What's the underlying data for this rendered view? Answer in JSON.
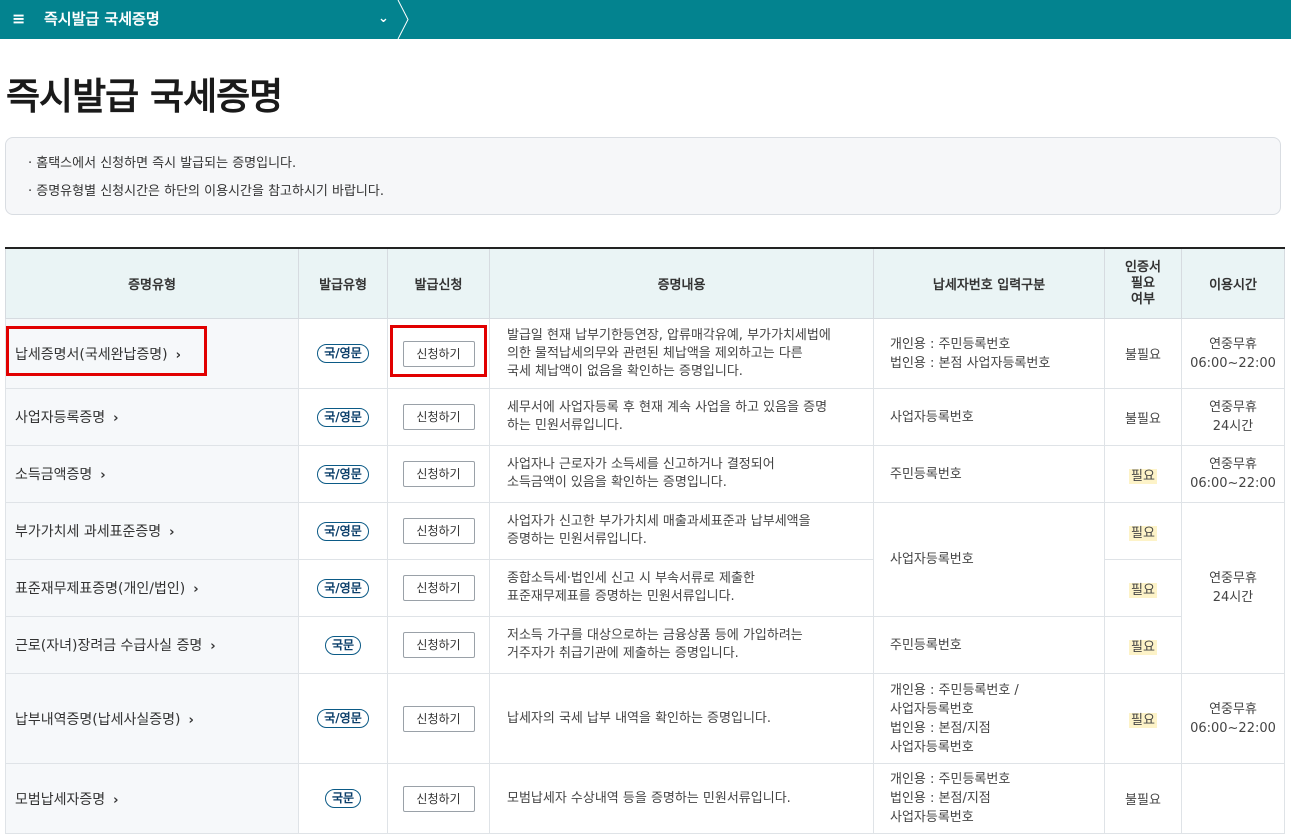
{
  "topbar": {
    "menu_icon": "hamburger-icon",
    "breadcrumb": "즉시발급 국세증명",
    "dropdown_icon": "chevron-down-icon"
  },
  "page_title": "즉시발급 국세증명",
  "notice": [
    "· 홈택스에서 신청하면 즉시 발급되는 증명입니다.",
    "· 증명유형별 신청시간은 하단의 이용시간을 참고하시기 바랍니다."
  ],
  "table": {
    "headers": {
      "type": "증명유형",
      "issue_type": "발급유형",
      "apply": "발급신청",
      "content": "증명내용",
      "tin_type": "납세자번호 입력구분",
      "cert_needed": "인증서\n필요\n여부",
      "hours": "이용시간"
    },
    "apply_label": "신청하기",
    "arrow": "›",
    "rows": [
      {
        "name": "납세증명서(국세완납증명)",
        "issue": "국/영문",
        "desc": "발급일 현재 납부기한등연장, 압류매각유예, 부가가치세법에\n의한 물적납세의무와 관련된 체납액을 제외하고는 다른\n국세 체납액이 없음을 확인하는 증명입니다.",
        "tin": "개인용 : 주민등록번호\n법인용 : 본점 사업자등록번호",
        "need": "불필요",
        "hours": "연중무휴\n06:00~22:00"
      },
      {
        "name": "사업자등록증명",
        "issue": "국/영문",
        "desc": "세무서에 사업자등록 후 현재 계속 사업을 하고 있음을 증명\n하는 민원서류입니다.",
        "tin": "사업자등록번호",
        "need": "불필요",
        "hours": "연중무휴\n24시간"
      },
      {
        "name": "소득금액증명",
        "issue": "국/영문",
        "desc": "사업자나 근로자가 소득세를 신고하거나 결정되어\n소득금액이 있음을 확인하는 증명입니다.",
        "tin": "주민등록번호",
        "need": "필요",
        "hours": "연중무휴\n06:00~22:00"
      },
      {
        "name": "부가가치세 과세표준증명",
        "issue": "국/영문",
        "desc": "사업자가 신고한 부가가치세 매출과세표준과 납부세액을\n증명하는 민원서류입니다.",
        "tin": "사업자등록번호",
        "need": "필요",
        "hours": "연중무휴\n24시간"
      },
      {
        "name": "표준재무제표증명(개인/법인)",
        "issue": "국/영문",
        "desc": "종합소득세·법인세 신고 시 부속서류로 제출한\n표준재무제표를 증명하는 민원서류입니다.",
        "need": "필요"
      },
      {
        "name": "근로(자녀)장려금 수급사실 증명",
        "issue": "국문",
        "desc": "저소득 가구를 대상으로하는 금융상품 등에 가입하려는\n거주자가 취급기관에 제출하는 증명입니다.",
        "tin": "주민등록번호",
        "need": "필요"
      },
      {
        "name": "납부내역증명(납세사실증명)",
        "issue": "국/영문",
        "desc": "납세자의 국세 납부 내역을 확인하는 증명입니다.",
        "tin": "개인용 : 주민등록번호 /\n사업자등록번호\n법인용 : 본점/지점\n사업자등록번호",
        "need": "필요",
        "hours": "연중무휴\n06:00~22:00"
      },
      {
        "name": "모범납세자증명",
        "issue": "국문",
        "desc": "모범납세자 수상내역 등을 증명하는 민원서류입니다.",
        "tin": "개인용 : 주민등록번호\n법인용 : 본점/지점\n사업자등록번호",
        "need": "불필요",
        "hours": ""
      }
    ]
  },
  "colors": {
    "topbar": "#03838f",
    "header_bg": "#eaf4f5",
    "highlight_box": "#e10000",
    "tag_border": "#0b5a86"
  }
}
